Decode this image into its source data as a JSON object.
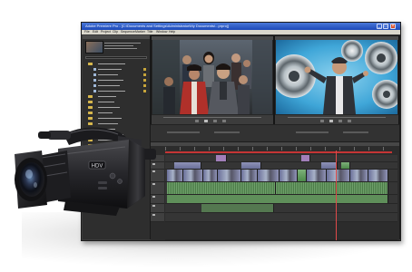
{
  "window": {
    "title": "Adobe Premiere Pro - [C:\\Documents and Settings\\Administrator\\My Documents\\...prproj]",
    "controls": {
      "minimize": "_",
      "maximize": "□",
      "close": "×"
    }
  },
  "menu": {
    "items": [
      "File",
      "Edit",
      "Project",
      "Clip",
      "Sequence",
      "Marker",
      "Title",
      "Window",
      "Help"
    ]
  },
  "camera": {
    "brand_badge": "HDV"
  },
  "colors": {
    "accent": "#c43535",
    "titlebar": "#1c48b8",
    "panel": "#2e2e2e",
    "video_clip": "#8f93b8",
    "audio_clip": "#6fa06b"
  }
}
